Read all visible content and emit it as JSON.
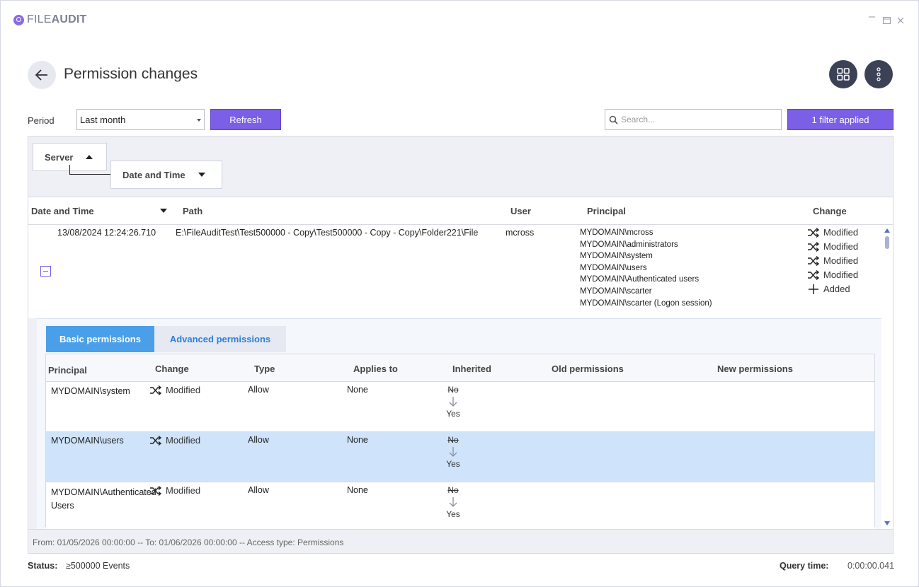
{
  "app": {
    "logo_light": "FILE",
    "logo_bold": "AUDIT"
  },
  "header": {
    "title": "Permission changes"
  },
  "toolbar": {
    "period_label": "Period",
    "period_value": "Last month",
    "refresh_label": "Refresh",
    "search_placeholder": "Search...",
    "filter_label": "1 filter applied"
  },
  "grouping": {
    "group1": "Server",
    "group2": "Date and Time"
  },
  "columns": {
    "date": "Date and Time",
    "path": "Path",
    "user": "User",
    "principal": "Principal",
    "change": "Change"
  },
  "record": {
    "date": "13/08/2024 12:24:26.710",
    "path": "E:\\FileAuditTest\\Test500000 - Copy\\Test500000 - Copy - Copy\\Folder221\\File",
    "user": "mcross",
    "principals": [
      "MYDOMAIN\\mcross",
      "MYDOMAIN\\administrators",
      "MYDOMAIN\\system",
      "MYDOMAIN\\users",
      "MYDOMAIN\\Authenticated users",
      "MYDOMAIN\\scarter",
      "MYDOMAIN\\scarter (Logon session)"
    ],
    "changes": [
      {
        "icon": "shuffle-icon",
        "label": "Modified"
      },
      {
        "icon": "shuffle-icon",
        "label": "Modified"
      },
      {
        "icon": "shuffle-icon",
        "label": "Modified"
      },
      {
        "icon": "shuffle-icon",
        "label": "Modified"
      },
      {
        "icon": "plus-icon",
        "label": "Added"
      }
    ]
  },
  "detail": {
    "tab_basic": "Basic permissions",
    "tab_advanced": "Advanced permissions",
    "columns": {
      "principal": "Principal",
      "change": "Change",
      "type": "Type",
      "applies_to": "Applies to",
      "inherited": "Inherited",
      "old_permissions": "Old permissions",
      "new_permissions": "New permissions"
    },
    "rows": [
      {
        "principal": "MYDOMAIN\\system",
        "change": "Modified",
        "type": "Allow",
        "applies_to": "None",
        "inherited_old": "No",
        "inherited_new": "Yes"
      },
      {
        "principal": "MYDOMAIN\\users",
        "change": "Modified",
        "type": "Allow",
        "applies_to": "None",
        "inherited_old": "No",
        "inherited_new": "Yes"
      },
      {
        "principal": "MYDOMAIN\\Authenticated Users",
        "change": "Modified",
        "type": "Allow",
        "applies_to": "None",
        "inherited_old": "No",
        "inherited_new": "Yes"
      }
    ]
  },
  "footer": {
    "query_summary": "From: 01/05/2026 00:00:00 -- To: 01/06/2026 00:00:00 -- Access type: Permissions"
  },
  "status": {
    "label": "Status:",
    "value": "≥500000 Events",
    "query_time_label": "Query time:",
    "query_time_value": "0:00:00.041"
  },
  "colors": {
    "accent": "#7b5fe6",
    "tab_active": "#4a9fe8",
    "selected_row": "#cfe4fb"
  }
}
